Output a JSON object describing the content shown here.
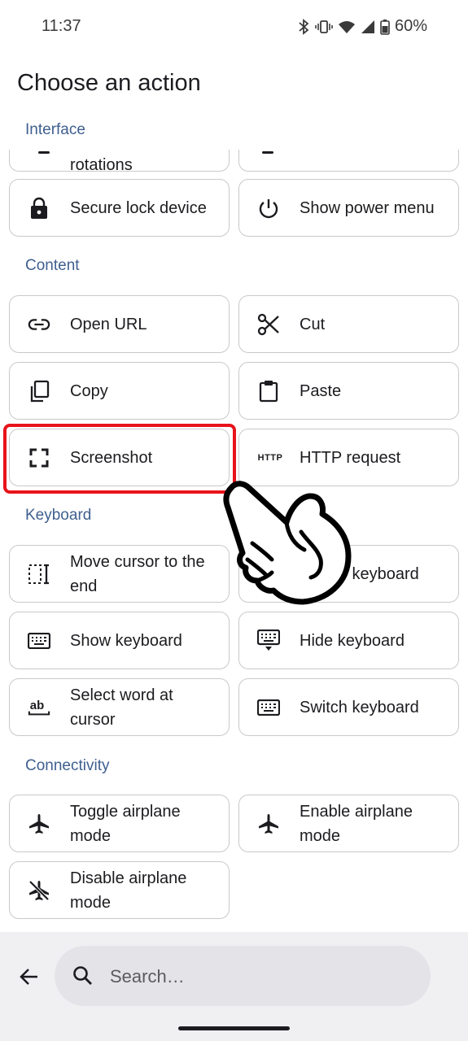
{
  "status_bar": {
    "time": "11:37",
    "battery": "60%"
  },
  "title": "Choose an action",
  "sections": {
    "interface": "Interface",
    "content": "Content",
    "keyboard": "Keyboard",
    "connectivity": "Connectivity"
  },
  "interface_items": {
    "rotations": "rotations",
    "secure_lock": "Secure lock device",
    "power_menu": "Show power menu"
  },
  "content_items": {
    "open_url": "Open URL",
    "cut": "Cut",
    "copy": "Copy",
    "paste": "Paste",
    "screenshot": "Screenshot",
    "http_request": "HTTP request",
    "http_icon_text": "HTTP"
  },
  "keyboard_items": {
    "move_cursor": "Move cursor to the end",
    "toggle_keyboard": "Toggle keyboard",
    "show_keyboard": "Show keyboard",
    "hide_keyboard": "Hide keyboard",
    "select_word": "Select word at cursor",
    "switch_keyboard": "Switch keyboard",
    "ab_icon_text": "ab"
  },
  "connectivity_items": {
    "toggle_airplane": "Toggle airplane mode",
    "enable_airplane": "Enable airplane mode",
    "disable_airplane": "Disable airplane mode"
  },
  "search": {
    "placeholder": "Search…"
  },
  "colors": {
    "section": "#3f5f90",
    "highlight": "#e8131b",
    "border": "#c9c9cc"
  },
  "overlay": {
    "icon": "pointing-hand-icon"
  }
}
